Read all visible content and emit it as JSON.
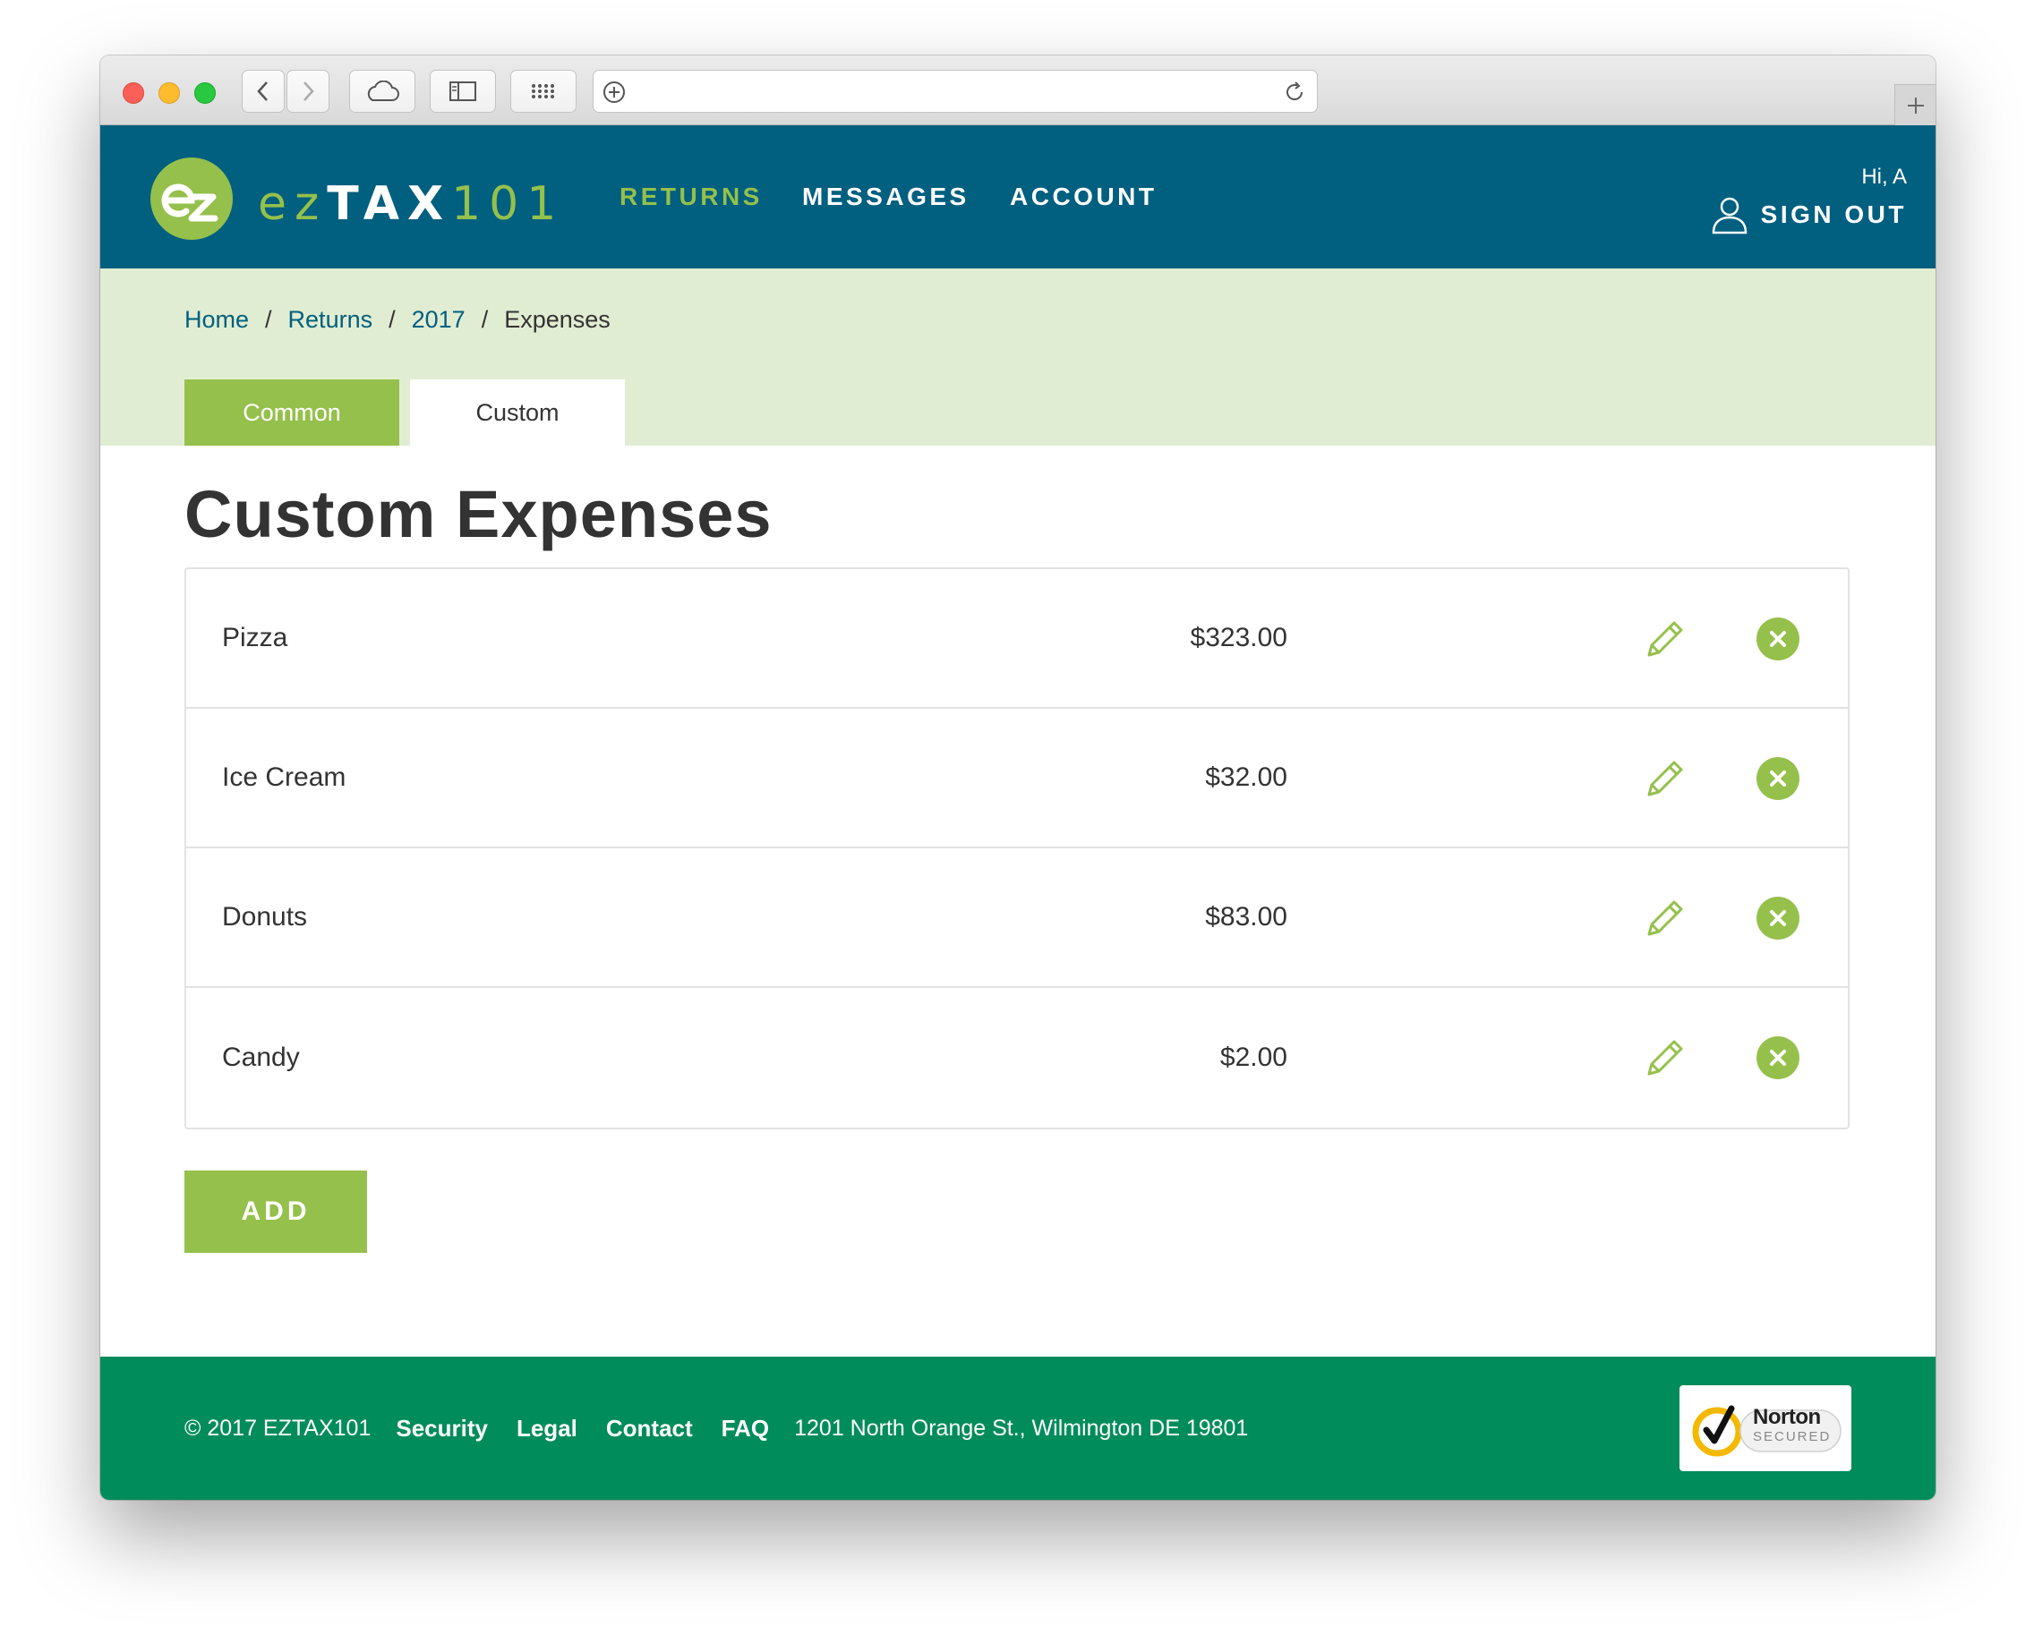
{
  "header": {
    "brand_ez": "ez",
    "brand_tax": "TAX",
    "brand_num": "101",
    "nav": {
      "returns": "RETURNS",
      "messages": "MESSAGES",
      "account": "ACCOUNT"
    },
    "greeting": "Hi, A",
    "sign_out": "SIGN OUT"
  },
  "breadcrumb": {
    "home": "Home",
    "returns": "Returns",
    "year": "2017",
    "current": "Expenses",
    "separator": "/"
  },
  "tabs": {
    "common": "Common",
    "custom": "Custom",
    "active": "custom"
  },
  "main": {
    "title": "Custom Expenses",
    "expenses": [
      {
        "name": "Pizza",
        "amount": "$323.00"
      },
      {
        "name": "Ice Cream",
        "amount": "$32.00"
      },
      {
        "name": "Donuts",
        "amount": "$83.00"
      },
      {
        "name": "Candy",
        "amount": "$2.00"
      }
    ],
    "add_label": "ADD"
  },
  "footer": {
    "copyright": "© 2017 EZTAX101",
    "links": [
      "Security",
      "Legal",
      "Contact",
      "FAQ"
    ],
    "address": "1201 North Orange St., Wilmington DE 19801",
    "badge_title": "Norton",
    "badge_subtitle": "SECURED"
  },
  "colors": {
    "header_bg": "#015f7f",
    "accent_green": "#95c04b",
    "band_bg": "#e1edd2",
    "footer_bg": "#008c5b",
    "text_dark": "#333333"
  },
  "icons": {
    "logo": "ez-logo-icon",
    "user": "user-icon",
    "edit": "pencil-icon",
    "delete": "close-circle-icon",
    "badge": "norton-checkmark-icon"
  }
}
